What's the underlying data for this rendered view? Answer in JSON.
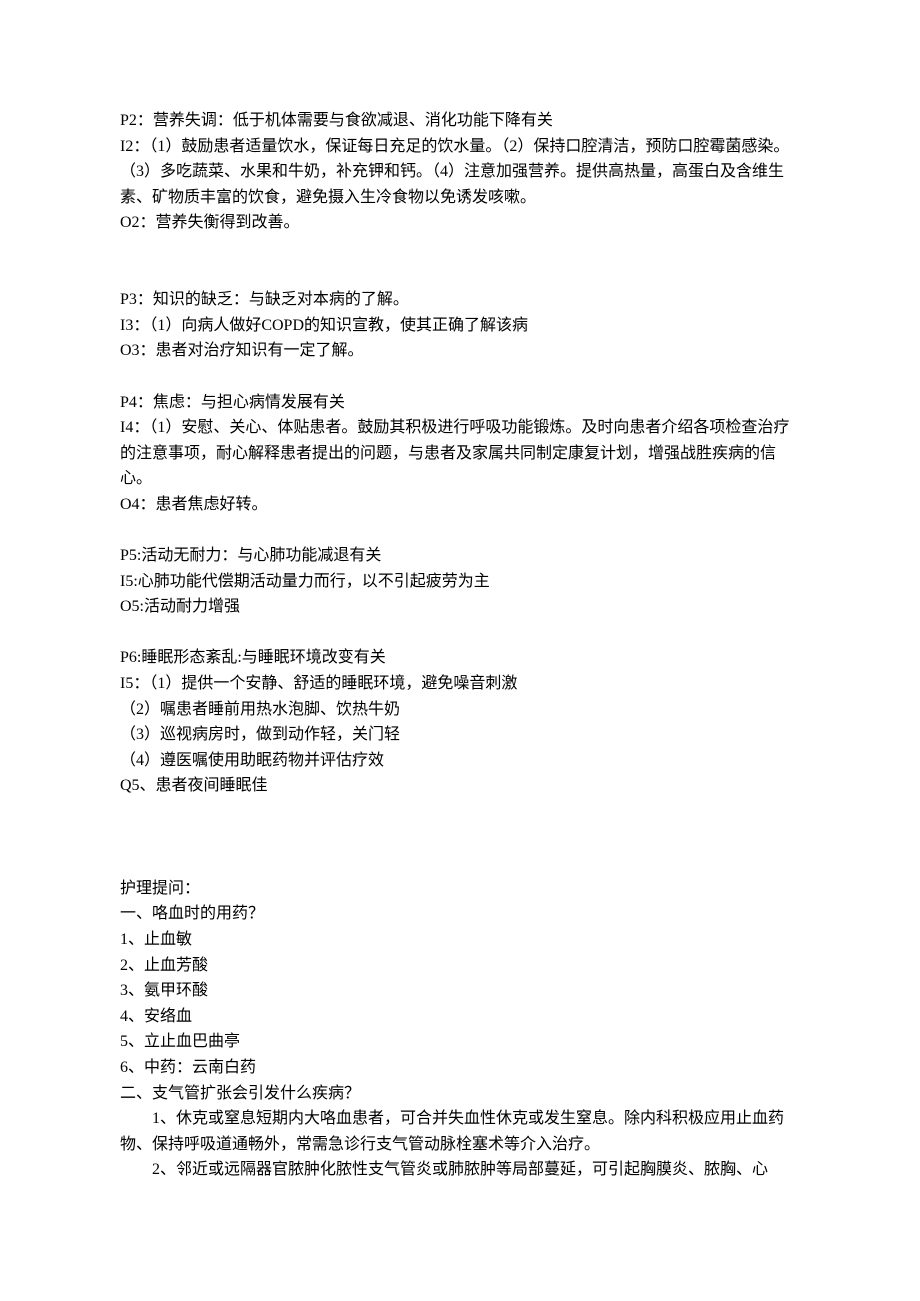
{
  "sections": [
    {
      "id": "p2",
      "label": "P2：营养失调：低于机体需要与食欲减退、消化功能下降有关",
      "intervention_label": "I2：（1）鼓励患者适量饮水，保证每日充足的饮水量。（2）保持口腔清洁，预防口腔霉菌感染。（3）多吃蔬菜、水果和牛奶，补充钾和钙。（4）注意加强营养。提供高热量，高蛋白及含维生素、矿物质丰富的饮食，避免摄入生冷食物以免诱发咳嗽。",
      "outcome_label": "O2：营养失衡得到改善。"
    },
    {
      "id": "p3",
      "label": "P3：知识的缺乏：与缺乏对本病的了解。",
      "intervention_label": "I3：（1）向病人做好COPD的知识宣教，使其正确了解该病",
      "outcome_label": "O3：患者对治疗知识有一定了解。"
    },
    {
      "id": "p4",
      "label": "P4：焦虑：与担心病情发展有关",
      "intervention_label": "I4：（1）安慰、关心、体贴患者。鼓励其积极进行呼吸功能锻炼。及时向患者介绍各项检查治疗的注意事项，耐心解释患者提出的问题，与患者及家属共同制定康复计划，增强战胜疾病的信心。",
      "outcome_label": "O4：患者焦虑好转。"
    },
    {
      "id": "p5",
      "label": "P5:活动无耐力：与心肺功能减退有关",
      "intervention_label": "I5:心肺功能代偿期活动量力而行，以不引起疲劳为主",
      "outcome_label": "O5:活动耐力增强"
    },
    {
      "id": "p6",
      "label": "P6:睡眠形态紊乱:与睡眠环境改变有关",
      "intervention_label": "I5：（1）提供一个安静、舒适的睡眠环境，避免噪音刺激",
      "sub_items": [
        "（2）嘱患者睡前用热水泡脚、饮热牛奶",
        "（3）巡视病房时，做到动作轻，关门轻",
        "（4）遵医嘱使用助眠药物并评估疗效"
      ],
      "outcome_label": "Q5、患者夜间睡眠佳"
    }
  ],
  "nursing_questions": {
    "title": "护理提问：",
    "q1": {
      "title": "一、咯血时的用药？",
      "items": [
        "1、止血敏",
        "2、止血芳酸",
        "3、氨甲环酸",
        "4、安络血",
        "5、立止血巴曲亭",
        "6、中药：云南白药"
      ]
    },
    "q2": {
      "title": "二、支气管扩张会引发什么疾病？",
      "items": [
        "1、休克或窒息短期内大咯血患者，可合并失血性休克或发生窒息。除内科积极应用止血药物、保持呼吸道通畅外，常需急诊行支气管动脉栓塞术等介入治疗。",
        "2、邻近或远隔器官脓肿化脓性支气管炎或肺脓肿等局部蔓延，可引起胸膜炎、脓胸、心"
      ]
    }
  }
}
